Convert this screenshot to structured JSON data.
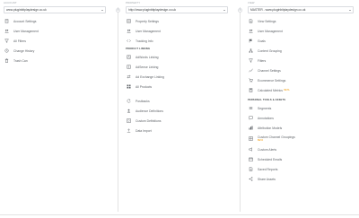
{
  "account": {
    "header": "ACCOUNT",
    "select_value": "www.pluginbitplaydesign.co.uk",
    "items": [
      {
        "label": "Account Settings"
      },
      {
        "label": "User Management"
      },
      {
        "label": "All Filters"
      },
      {
        "label": "Change History"
      },
      {
        "label": "Trash Can"
      }
    ]
  },
  "property": {
    "header": "PROPERTY",
    "select_value": "http://www.pluginbitplaydesign.co.uk",
    "items_top": [
      {
        "label": "Property Settings"
      },
      {
        "label": "User Management"
      },
      {
        "label": "Tracking Info"
      }
    ],
    "section_product_linking": "PRODUCT LINKING",
    "items_linking": [
      {
        "label": "AdWords Linking"
      },
      {
        "label": "AdSense Linking"
      },
      {
        "label": "Ad Exchange Linking"
      },
      {
        "label": "All Products"
      }
    ],
    "items_bottom": [
      {
        "label": "Postbacks"
      },
      {
        "label": "Audience Definitions"
      },
      {
        "label": "Custom Definitions"
      },
      {
        "label": "Data Import"
      }
    ]
  },
  "view": {
    "header": "VIEW",
    "select_value": "MASTER - www.pluginbitplaydesign.co.uk",
    "items_top": [
      {
        "label": "View Settings"
      },
      {
        "label": "User Management"
      },
      {
        "label": "Goals"
      },
      {
        "label": "Content Grouping"
      },
      {
        "label": "Filters"
      },
      {
        "label": "Channel Settings"
      },
      {
        "label": "Ecommerce Settings"
      },
      {
        "label": "Calculated Metrics",
        "badge": "BETA"
      }
    ],
    "section_personal": "PERSONAL TOOLS & ASSETS",
    "items_personal": [
      {
        "label": "Segments"
      },
      {
        "label": "Annotations"
      },
      {
        "label": "Attribution Models"
      },
      {
        "label": "Custom Channel Groupings",
        "badge": "BETA"
      },
      {
        "label": "Custom Alerts"
      },
      {
        "label": "Scheduled Emails"
      },
      {
        "label": "Saved Reports"
      },
      {
        "label": "Share Assets"
      }
    ]
  },
  "colors": {
    "icon": "#5f6368",
    "beta": "#f29900",
    "border": "#dadce0"
  }
}
